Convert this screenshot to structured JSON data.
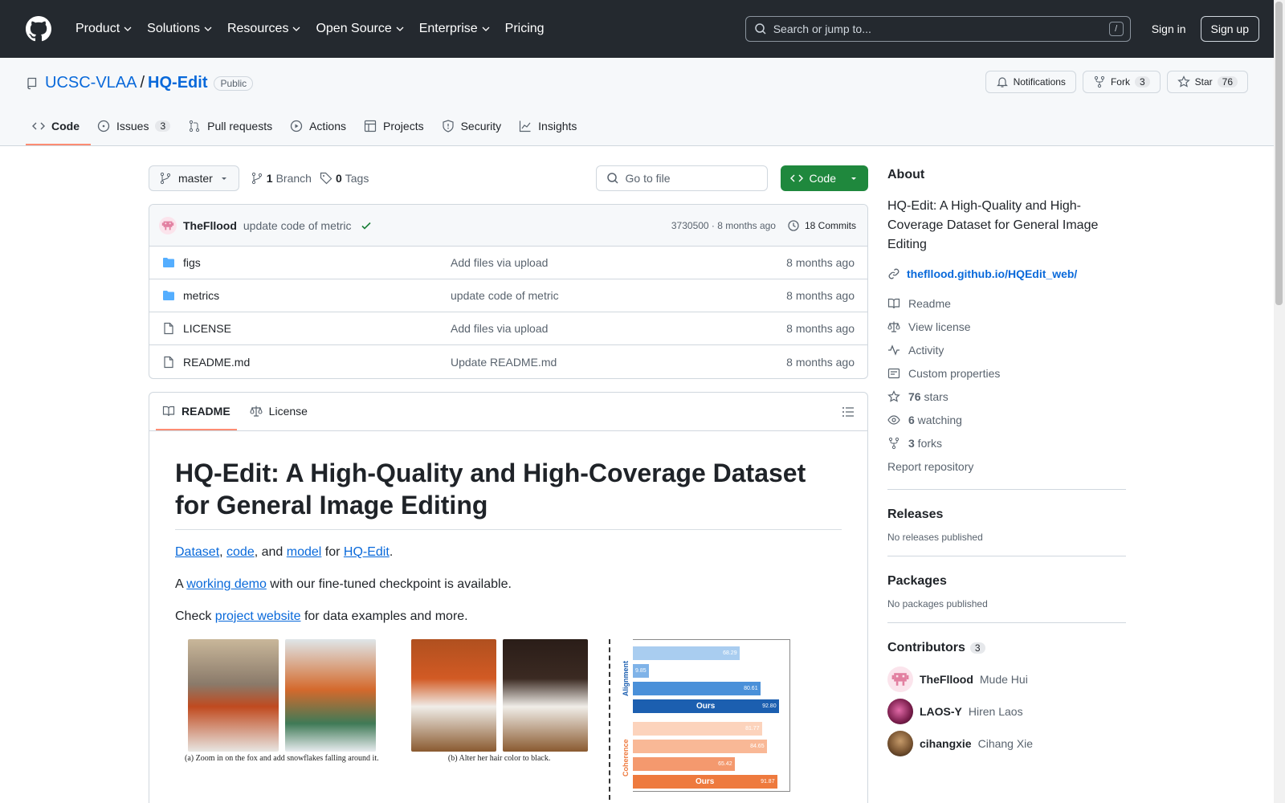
{
  "header": {
    "nav": [
      "Product",
      "Solutions",
      "Resources",
      "Open Source",
      "Enterprise",
      "Pricing"
    ],
    "search_placeholder": "Search or jump to...",
    "search_shortcut": "/",
    "signin": "Sign in",
    "signup": "Sign up"
  },
  "repo": {
    "owner": "UCSC-VLAA",
    "name": "HQ-Edit",
    "visibility": "Public",
    "notifications": "Notifications",
    "fork_label": "Fork",
    "fork_count": "3",
    "star_label": "Star",
    "star_count": "76",
    "tabs": [
      {
        "label": "Code",
        "count": ""
      },
      {
        "label": "Issues",
        "count": "3"
      },
      {
        "label": "Pull requests",
        "count": ""
      },
      {
        "label": "Actions",
        "count": ""
      },
      {
        "label": "Projects",
        "count": ""
      },
      {
        "label": "Security",
        "count": ""
      },
      {
        "label": "Insights",
        "count": ""
      }
    ]
  },
  "toolbar": {
    "branch": "master",
    "branch_count": "1",
    "branch_label": "Branch",
    "tag_count": "0",
    "tag_label": "Tags",
    "goto_placeholder": "Go to file",
    "code_label": "Code"
  },
  "commit": {
    "user": "TheFllood",
    "message": "update code of metric",
    "meta": "3730500 · 8 months ago",
    "commits": "18 Commits"
  },
  "files": [
    {
      "name": "figs",
      "type": "dir",
      "message": "Add files via upload",
      "date": "8 months ago"
    },
    {
      "name": "metrics",
      "type": "dir",
      "message": "update code of metric",
      "date": "8 months ago"
    },
    {
      "name": "LICENSE",
      "type": "file",
      "message": "Add files via upload",
      "date": "8 months ago"
    },
    {
      "name": "README.md",
      "type": "file",
      "message": "Update README.md",
      "date": "8 months ago"
    }
  ],
  "readme": {
    "tab_readme": "README",
    "tab_license": "License",
    "title": "HQ-Edit: A High-Quality and High-Coverage Dataset for General Image Editing",
    "p1": {
      "dataset": "Dataset",
      "s1": ", ",
      "code": "code",
      "s2": ", and ",
      "model": "model",
      "s3": " for ",
      "hq": "HQ-Edit",
      "s4": "."
    },
    "p2": {
      "a": "A ",
      "demo": "working demo",
      "b": " with our fine-tuned checkpoint is available."
    },
    "p3": {
      "a": "Check ",
      "site": "project website",
      "b": " for data examples and more."
    },
    "caption_a": "(a) Zoom in on the fox and add snowflakes falling around it.",
    "caption_b": "(b) Alter her hair color to black.",
    "chart": {
      "alignment_label": "Alignment",
      "coherence_label": "Coherence",
      "ours_label": "Ours",
      "alignment": [
        {
          "value": "68.29",
          "w": 0.68,
          "c": "#a9cdf0"
        },
        {
          "value": "9.85",
          "w": 0.1,
          "c": "#7fb3e8"
        },
        {
          "value": "80.61",
          "w": 0.81,
          "c": "#4a90d9"
        },
        {
          "value": "92.80",
          "w": 0.93,
          "c": "#1c5fb0",
          "ours": true
        }
      ],
      "coherence": [
        {
          "value": "81.77",
          "w": 0.82,
          "c": "#fcd3bc"
        },
        {
          "value": "84.65",
          "w": 0.85,
          "c": "#f9b896"
        },
        {
          "value": "65.42",
          "w": 0.65,
          "c": "#f4996e"
        },
        {
          "value": "91.87",
          "w": 0.92,
          "c": "#ee7a3e",
          "ours": true
        }
      ]
    }
  },
  "about": {
    "title": "About",
    "description": "HQ-Edit: A High-Quality and High-Coverage Dataset for General Image Editing",
    "link": "thefllood.github.io/HQEdit_web/",
    "items": [
      {
        "icon": "book-icon",
        "label": "Readme",
        "bold": ""
      },
      {
        "icon": "law-icon",
        "label": "View license",
        "bold": ""
      },
      {
        "icon": "pulse-icon",
        "label": "Activity",
        "bold": ""
      },
      {
        "icon": "note-icon",
        "label": "Custom properties",
        "bold": ""
      },
      {
        "icon": "star-icon",
        "label": " stars",
        "bold": "76"
      },
      {
        "icon": "eye-icon",
        "label": " watching",
        "bold": "6"
      },
      {
        "icon": "fork-icon",
        "label": " forks",
        "bold": "3"
      }
    ],
    "report": "Report repository"
  },
  "releases": {
    "title": "Releases",
    "empty": "No releases published"
  },
  "packages": {
    "title": "Packages",
    "empty": "No packages published"
  },
  "contributors": {
    "title": "Contributors",
    "count": "3",
    "list": [
      {
        "login": "TheFllood",
        "name": "Mude Hui"
      },
      {
        "login": "LAOS-Y",
        "name": "Hiren Laos"
      },
      {
        "login": "cihangxie",
        "name": "Cihang Xie"
      }
    ]
  }
}
